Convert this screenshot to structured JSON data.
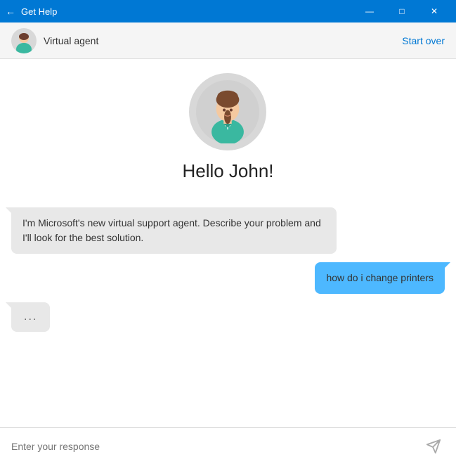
{
  "titlebar": {
    "title": "Get Help",
    "back_label": "←",
    "minimize_label": "—",
    "maximize_label": "□",
    "close_label": "✕"
  },
  "header": {
    "agent_name": "Virtual agent",
    "start_over_label": "Start over"
  },
  "chat": {
    "greeting": "Hello John!",
    "messages": [
      {
        "type": "agent",
        "text": "I'm Microsoft's new virtual support agent. Describe your problem and I'll look for the best solution."
      },
      {
        "type": "user",
        "text": "how do i change printers"
      },
      {
        "type": "typing",
        "text": "..."
      }
    ]
  },
  "input": {
    "placeholder": "Enter your response"
  },
  "colors": {
    "titlebar_bg": "#0078d4",
    "user_bubble": "#4db8ff",
    "agent_bubble": "#e8e8e8",
    "start_over": "#0078d4"
  }
}
